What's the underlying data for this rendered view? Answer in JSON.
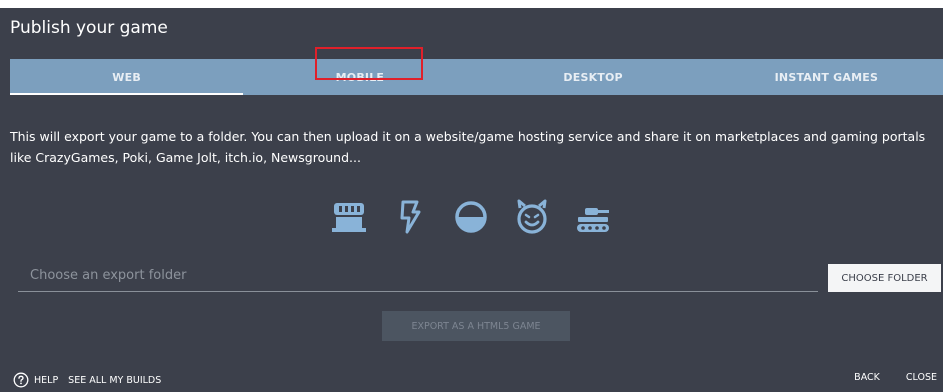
{
  "dialog": {
    "title": "Publish your game"
  },
  "tabs": [
    {
      "label": "WEB",
      "active": true
    },
    {
      "label": "MOBILE",
      "active": false
    },
    {
      "label": "DESKTOP",
      "active": false
    },
    {
      "label": "INSTANT GAMES",
      "active": false
    }
  ],
  "description": "This will export your game to a folder. You can then upload it on a website/game hosting service and share it on marketplaces and gaming portals like CrazyGames, Poki, Game Jolt, itch.io, Newsground...",
  "platform_icons": [
    "store-icon",
    "lightning-icon",
    "half-circle-icon",
    "devil-face-icon",
    "tank-icon"
  ],
  "export_folder": {
    "placeholder": "Choose an export folder",
    "value": ""
  },
  "buttons": {
    "choose_folder": "CHOOSE FOLDER",
    "export": "EXPORT AS A HTML5 GAME"
  },
  "footer": {
    "help": "HELP",
    "see_all_builds": "SEE ALL MY BUILDS",
    "back": "BACK",
    "close": "CLOSE"
  },
  "colors": {
    "background": "#3c404b",
    "tab_bar": "#7c9fbe",
    "icon_accent": "#89b3d8",
    "highlight_box": "#e0202a"
  }
}
